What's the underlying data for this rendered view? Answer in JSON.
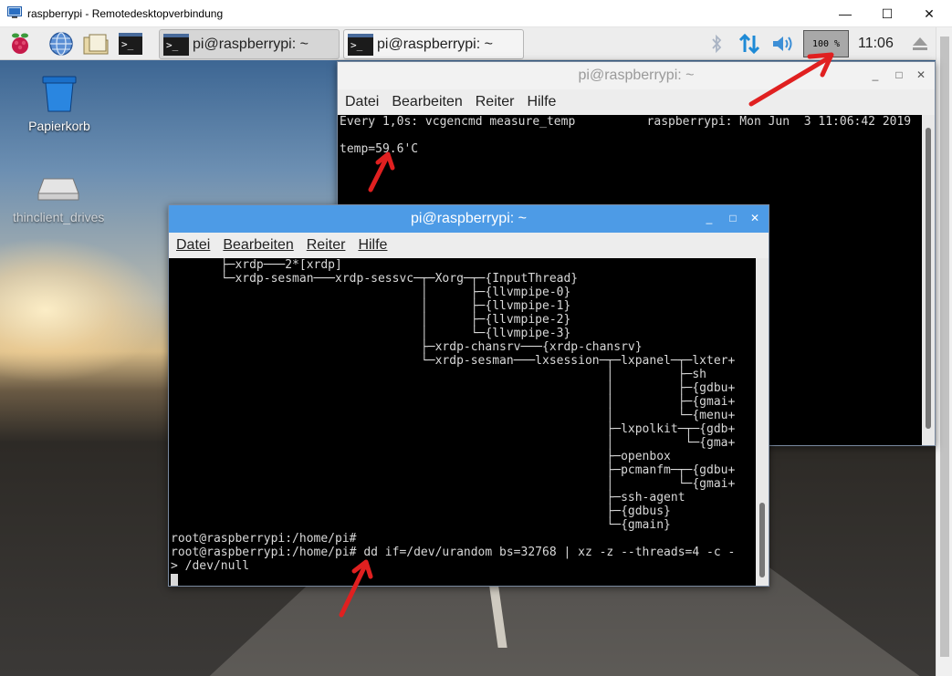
{
  "rdp_window": {
    "title": "raspberrypi - Remotedesktopverbindung",
    "controls": {
      "minimize": "—",
      "maximize": "☐",
      "close": "✕"
    }
  },
  "taskbar": {
    "launcher_icons": [
      "raspberry-menu-icon",
      "web-browser-icon",
      "file-manager-icon",
      "terminal-icon"
    ],
    "tasks": [
      {
        "label": "pi@raspberrypi: ~",
        "active": true
      },
      {
        "label": "pi@raspberrypi: ~",
        "active": false
      }
    ],
    "tray": {
      "bluetooth_icon": "bluetooth-icon",
      "network_icon": "network-updown-icon",
      "volume_icon": "speaker-icon",
      "cpu_monitor": "100 %",
      "clock": "11:06",
      "eject_icon": "eject-icon"
    }
  },
  "desktop": {
    "icons": [
      {
        "label": "Papierkorb",
        "icon": "trash-icon"
      },
      {
        "label": "thinclient_drives",
        "icon": "drive-icon"
      }
    ]
  },
  "term_back": {
    "title": "pi@raspberrypi: ~",
    "menu": [
      "Datei",
      "Bearbeiten",
      "Reiter",
      "Hilfe"
    ],
    "controls": {
      "minimize": "_",
      "maximize": "□",
      "close": "✕"
    },
    "lines": [
      "Every 1,0s: vcgencmd measure_temp          raspberrypi: Mon Jun  3 11:06:42 2019",
      "",
      "temp=59.6'C"
    ]
  },
  "term_front": {
    "title": "pi@raspberrypi: ~",
    "menu": [
      "Datei",
      "Bearbeiten",
      "Reiter",
      "Hilfe"
    ],
    "controls": {
      "minimize": "_",
      "maximize": "□",
      "close": "✕"
    },
    "lines": [
      "       ├─xrdp───2*[xrdp]",
      "       └─xrdp-sesman───xrdp-sessvc─┬─Xorg─┬─{InputThread}",
      "                                   │      ├─{llvmpipe-0}",
      "                                   │      ├─{llvmpipe-1}",
      "                                   │      ├─{llvmpipe-2}",
      "                                   │      └─{llvmpipe-3}",
      "                                   ├─xrdp-chansrv───{xrdp-chansrv}",
      "                                   └─xrdp-sesman───lxsession─┬─lxpanel─┬─lxter+",
      "                                                             │         ├─sh",
      "                                                             │         ├─{gdbu+",
      "                                                             │         ├─{gmai+",
      "                                                             │         └─{menu+",
      "                                                             ├─lxpolkit─┬─{gdb+",
      "                                                             │          └─{gma+",
      "                                                             ├─openbox",
      "                                                             ├─pcmanfm─┬─{gdbu+",
      "                                                             │         └─{gmai+",
      "                                                             ├─ssh-agent",
      "                                                             ├─{gdbus}",
      "                                                             └─{gmain}",
      "root@raspberrypi:/home/pi#",
      "root@raspberrypi:/home/pi# dd if=/dev/urandom bs=32768 | xz -z --threads=4 -c -",
      "> /dev/null"
    ]
  },
  "colors": {
    "annotation_arrow": "#e02020",
    "back_title_bg": "#f2f2f2",
    "front_title_bg": "#4d9be6"
  }
}
